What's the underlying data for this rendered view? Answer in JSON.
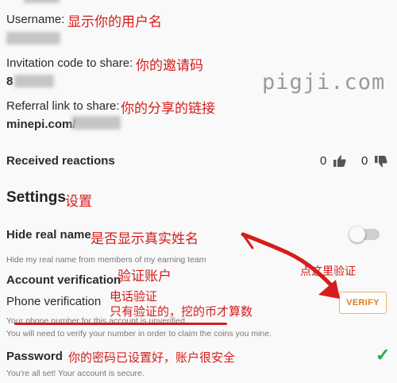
{
  "profile": {
    "username_label": "Username:",
    "invitation_label": "Invitation code to share:",
    "invitation_code_prefix": "8",
    "referral_label": "Referral link to share:",
    "referral_prefix": "minepi.com/"
  },
  "reactions": {
    "label": "Received reactions",
    "likes": "0",
    "dislikes": "0",
    "like_icon": "thumbs-up-icon",
    "dislike_icon": "thumbs-down-icon"
  },
  "settings": {
    "title": "Settings",
    "hide_real_name": {
      "label": "Hide real name",
      "description": "Hide my real name from members of my earning team",
      "toggle_on": false
    },
    "account_verification": {
      "title": "Account verification",
      "phone_label": "Phone verification",
      "status_text": "Your phone number for this account is unverified.",
      "need_text": "You will need to verify your number in order to claim the coins you mine.",
      "verify_button": "VERIFY"
    },
    "password": {
      "label": "Password",
      "status": "You're all set! Your account is secure.",
      "icon": "checkmark-icon"
    }
  },
  "annotations": {
    "username": "显示你的用户名",
    "invitation": "你的邀请码",
    "referral": "你的分享的链接",
    "settings": "设置",
    "hide_name": "是否显示真实姓名",
    "verify_account": "验证账户",
    "click_here": "点这里验证",
    "phone_line1": "电话验证",
    "phone_line2": "只有验证的，挖的币才算数",
    "password": "你的密码已设置好，账户很安全"
  },
  "watermark": "pigji.com",
  "colors": {
    "annotation_red": "#d61c1c",
    "verify_orange": "#e07a1f",
    "check_green": "#27a839"
  }
}
